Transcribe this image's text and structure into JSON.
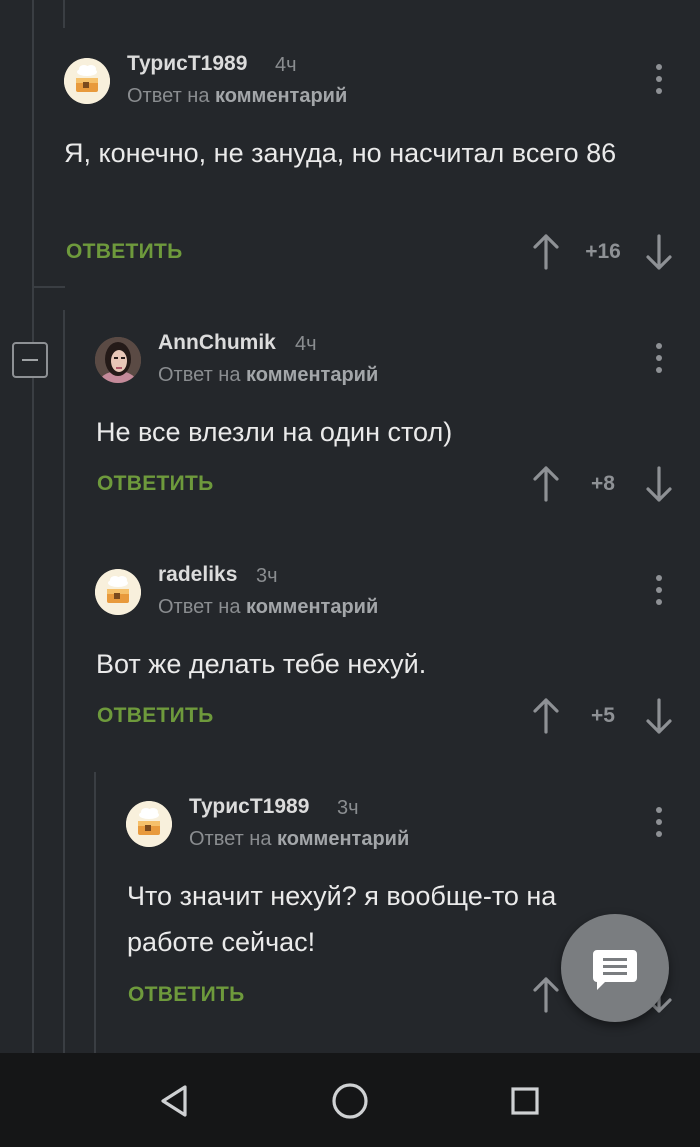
{
  "comments": [
    {
      "username": "ТурисТ1989",
      "time": "4ч",
      "reply_prefix": "Ответ на",
      "reply_target": "комментарий",
      "text": "Я, конечно, не зануда, но насчитал всего 86",
      "reply_label": "ОТВЕТИТЬ",
      "rating": "+16",
      "avatar": "cake-avatar"
    },
    {
      "username": "AnnChumik",
      "time": "4ч",
      "reply_prefix": "Ответ на",
      "reply_target": "комментарий",
      "text": "Не все влезли на один стол)",
      "reply_label": "ОТВЕТИТЬ",
      "rating": "+8",
      "avatar": "photo-avatar"
    },
    {
      "username": "radeliks",
      "time": "3ч",
      "reply_prefix": "Ответ на",
      "reply_target": "комментарий",
      "text": "Вот же делать тебе нехуй.",
      "reply_label": "ОТВЕТИТЬ",
      "rating": "+5",
      "avatar": "cake-avatar"
    },
    {
      "username": "ТурисТ1989",
      "time": "3ч",
      "reply_prefix": "Ответ на",
      "reply_target": "комментарий",
      "text": "Что значит нехуй? я вообще-то на работе сейчас!",
      "reply_label": "ОТВЕТИТЬ",
      "rating": "",
      "avatar": "cake-avatar"
    }
  ],
  "icons": {
    "fab": "comment-icon",
    "nav": [
      "back-triangle-icon",
      "home-circle-icon",
      "recents-square-icon"
    ],
    "collapse": "minus-icon",
    "more": "more-vertical-icon",
    "upvote": "arrow-up-icon",
    "downvote": "arrow-down-icon"
  },
  "colors": {
    "background": "#24272b",
    "reply_green": "#6e9a3c",
    "muted": "#8a8d90",
    "navbar": "#151617",
    "fab": "#7a7d80"
  }
}
